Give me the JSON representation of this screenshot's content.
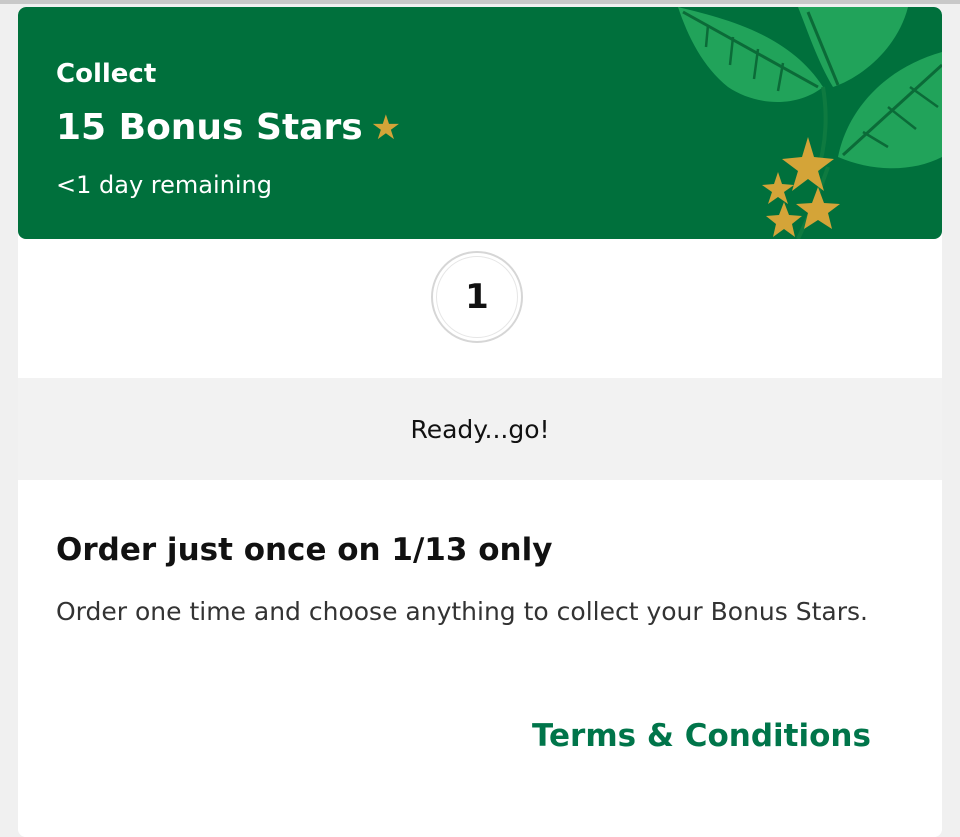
{
  "hero": {
    "eyebrow": "Collect",
    "title": "15 Bonus Stars",
    "title_star": "★",
    "remaining": "<1 day remaining",
    "art_icon": "coffee-leaves-stars-illustration"
  },
  "progress": {
    "count": "1"
  },
  "status": {
    "text": "Ready...go!"
  },
  "offer": {
    "heading": "Order just once on 1/13 only",
    "description": "Order one time and choose anything to collect your Bonus Stars.",
    "terms_link": "Terms & Conditions"
  },
  "colors": {
    "brand_green": "#00703c",
    "leaf_green": "#1fa35c",
    "star_gold": "#d4a438",
    "link_green": "#00754a"
  }
}
